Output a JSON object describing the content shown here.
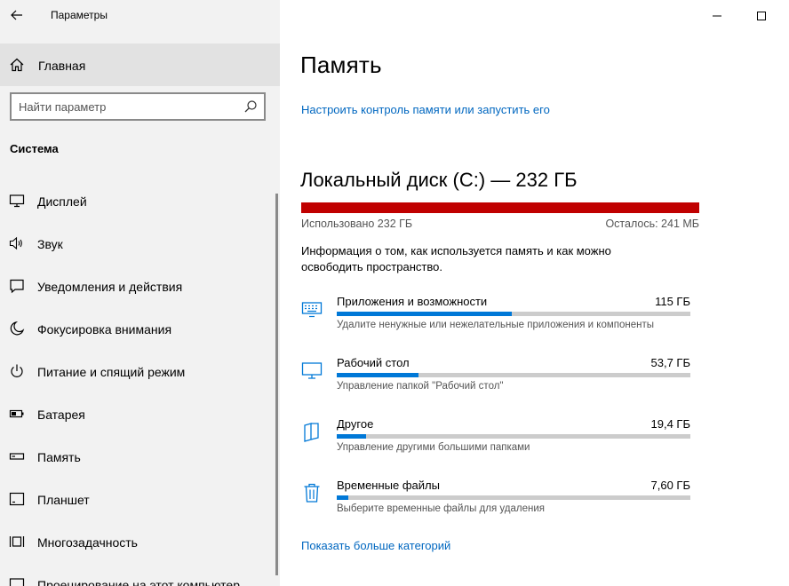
{
  "app": {
    "title": "Параметры"
  },
  "sidebar": {
    "home_label": "Главная",
    "search_placeholder": "Найти параметр",
    "section_title": "Система",
    "items": [
      {
        "label": "Дисплей",
        "icon": "monitor-icon"
      },
      {
        "label": "Звук",
        "icon": "speaker-icon"
      },
      {
        "label": "Уведомления и действия",
        "icon": "notification-icon"
      },
      {
        "label": "Фокусировка внимания",
        "icon": "moon-icon"
      },
      {
        "label": "Питание и спящий режим",
        "icon": "power-icon"
      },
      {
        "label": "Батарея",
        "icon": "battery-icon"
      },
      {
        "label": "Память",
        "icon": "storage-icon"
      },
      {
        "label": "Планшет",
        "icon": "tablet-icon"
      },
      {
        "label": "Многозадачность",
        "icon": "multitasking-icon"
      },
      {
        "label": "Проецирование на этот компьютер",
        "icon": "projection-icon"
      }
    ]
  },
  "main": {
    "title": "Память",
    "configure_link": "Настроить контроль памяти или запустить его",
    "disk": {
      "title": "Локальный диск (C:) — 232 ГБ",
      "used_label": "Использовано 232 ГБ",
      "free_label": "Осталось: 241 МБ",
      "used_fraction": 0.999,
      "bar_color": "#c00000"
    },
    "info_text": "Информация о том, как используется память и как можно освободить пространство.",
    "categories": [
      {
        "name": "Приложения и возможности",
        "size": "115 ГБ",
        "description": "Удалите ненужные или нежелательные приложения и компоненты",
        "fraction": 0.495,
        "icon": "keyboard-icon"
      },
      {
        "name": "Рабочий стол",
        "size": "53,7 ГБ",
        "description": "Управление папкой \"Рабочий стол\"",
        "fraction": 0.231,
        "icon": "desktop-icon"
      },
      {
        "name": "Другое",
        "size": "19,4 ГБ",
        "description": "Управление другими большими папками",
        "fraction": 0.083,
        "icon": "folder-icon"
      },
      {
        "name": "Временные файлы",
        "size": "7,60 ГБ",
        "description": "Выберите временные файлы для удаления",
        "fraction": 0.033,
        "icon": "trash-icon"
      }
    ],
    "show_more_link": "Показать больше категорий",
    "accent_color": "#0078d7"
  }
}
